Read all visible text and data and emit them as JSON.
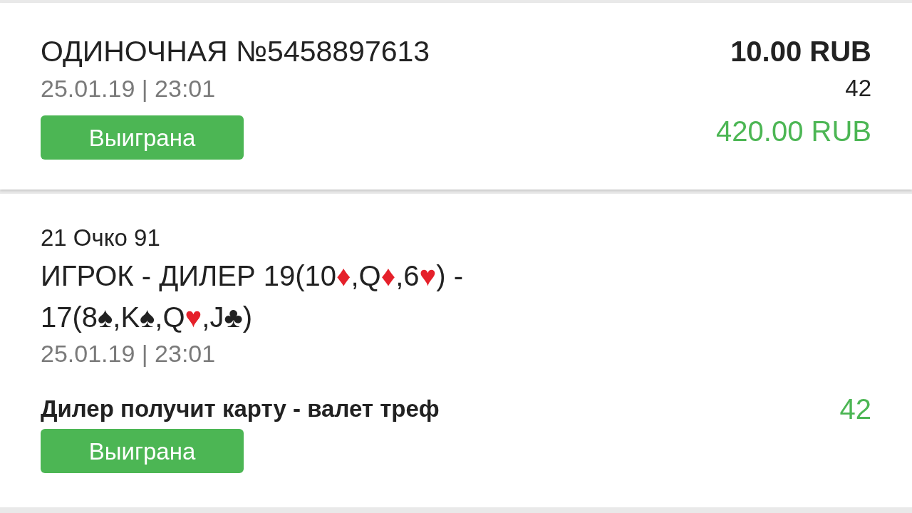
{
  "bet": {
    "title": "ОДИНОЧНАЯ №5458897613",
    "date": "25.01.19 | 23:01",
    "status": "Выиграна",
    "stake": "10.00 RUB",
    "odds": "42",
    "payout": "420.00 RUB"
  },
  "event": {
    "game": "21 Очко 91",
    "parts": [
      {
        "text": "ИГРОК - ДИЛЕР 19(10"
      },
      {
        "text": "♦",
        "color": "#e5202a"
      },
      {
        "text": ",Q"
      },
      {
        "text": "♦",
        "color": "#e5202a"
      },
      {
        "text": ",6"
      },
      {
        "text": "♥",
        "color": "#e5202a"
      },
      {
        "text": ") - 17(8"
      },
      {
        "text": "♠",
        "color": "#222222"
      },
      {
        "text": ",K"
      },
      {
        "text": "♠",
        "color": "#222222"
      },
      {
        "text": ",Q"
      },
      {
        "text": "♥",
        "color": "#e5202a"
      },
      {
        "text": ",J"
      },
      {
        "text": "♣",
        "color": "#222222"
      },
      {
        "text": ")"
      }
    ],
    "date": "25.01.19 | 23:01",
    "outcome": "Дилер получит карту - валет треф",
    "odds": "42",
    "status": "Выиграна"
  }
}
